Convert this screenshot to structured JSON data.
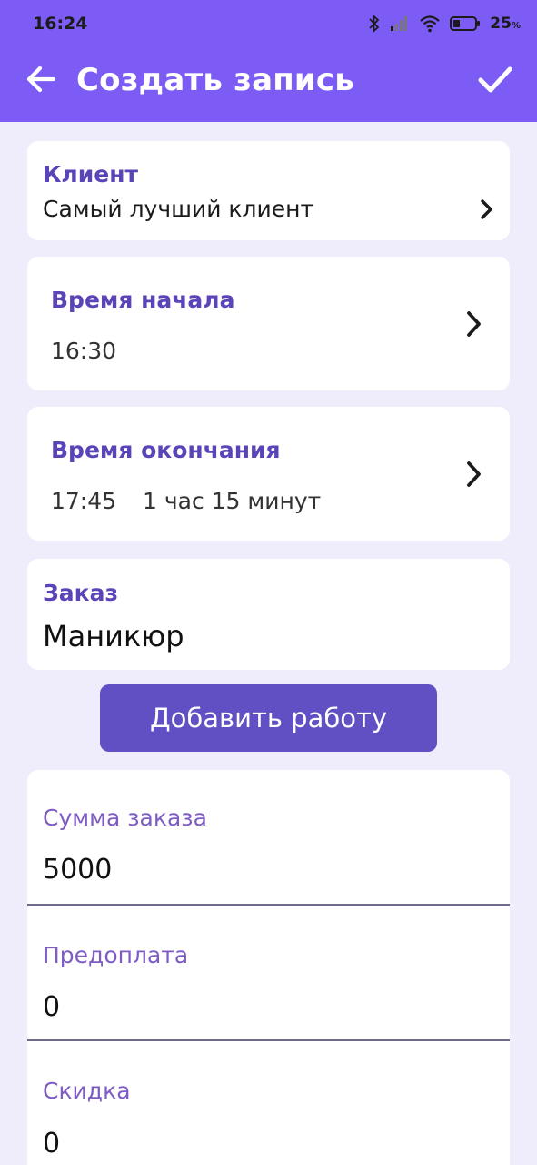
{
  "status_bar": {
    "time": "16:24",
    "battery": "25",
    "battery_unit": "%",
    "icons": [
      "bluetooth-icon",
      "signal-icon",
      "wifi-icon",
      "battery-icon"
    ]
  },
  "header": {
    "title": "Создать запись",
    "background": "#7c5cf5",
    "back_icon": "arrow-left-icon",
    "confirm_icon": "check-icon"
  },
  "client": {
    "label": "Клиент",
    "value": "Самый лучший клиент"
  },
  "start_time": {
    "label": "Время начала",
    "value": "16:30"
  },
  "end_time": {
    "label": "Время окончания",
    "value": "17:45",
    "duration": "1 час 15 минут"
  },
  "order": {
    "label": "Заказ",
    "value": "Маникюр"
  },
  "add_work_button": "Добавить работу",
  "form": {
    "sum": {
      "label": "Сумма заказа",
      "value": "5000"
    },
    "prepayment": {
      "label": "Предоплата",
      "value": "0"
    },
    "discount": {
      "label": "Скидка",
      "value": "0"
    }
  },
  "colors": {
    "accent": "#7c5cf5",
    "button": "#6150c4",
    "label": "#5b43b8",
    "background": "#efecfb"
  }
}
